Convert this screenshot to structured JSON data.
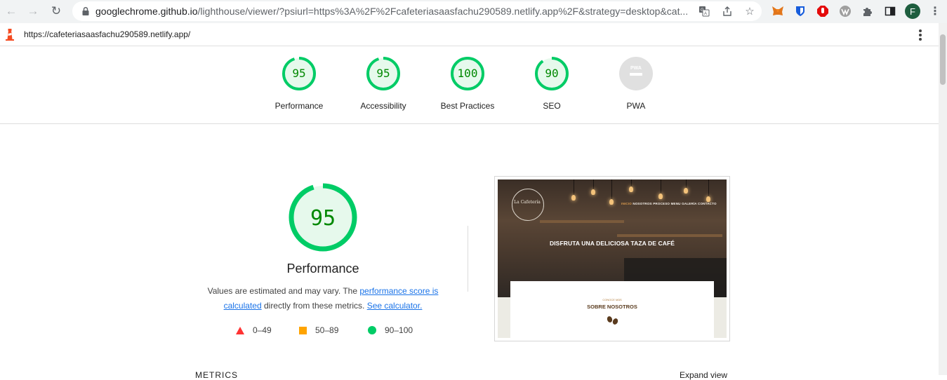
{
  "browser": {
    "url_host": "googlechrome.github.io",
    "url_rest": "/lighthouse/viewer/?psiurl=https%3A%2F%2Fcafeteriasaasfachu290589.netlify.app%2F&strategy=desktop&cat...",
    "avatar_initial": "F"
  },
  "report": {
    "url": "https://cafeteriasaasfachu290589.netlify.app/"
  },
  "gauges": [
    {
      "label": "Performance",
      "score": "95",
      "value": 95
    },
    {
      "label": "Accessibility",
      "score": "95",
      "value": 95
    },
    {
      "label": "Best Practices",
      "score": "100",
      "value": 100
    },
    {
      "label": "SEO",
      "score": "90",
      "value": 90
    },
    {
      "label": "PWA",
      "badge": "PWA"
    }
  ],
  "main": {
    "score": "95",
    "value": 95,
    "title": "Performance",
    "desc_pre": "Values are estimated and may vary. The ",
    "link_score": "performance score is calculated",
    "desc_mid": " directly from these metrics. ",
    "link_calc": "See calculator."
  },
  "legend": [
    {
      "range": "0–49"
    },
    {
      "range": "50–89"
    },
    {
      "range": "90–100"
    }
  ],
  "screenshot": {
    "logo": "La Cafetería",
    "nav_active": "INICIO",
    "nav_rest": "NOSOTROS  PROCESO  MENU  GALERÍA  CONTACTO",
    "headline": "DISFRUTA UNA DELICIOSA TAZA DE CAFÉ",
    "kicker": "CONOCE MÁS",
    "subheading": "SOBRE NOSOTROS"
  },
  "bottom": {
    "left_heading": "METRICS",
    "right_heading": "Expand view"
  },
  "colors": {
    "pass": "#0c6",
    "pass_text": "#008800",
    "pass_bg": "#e6f9ec",
    "average": "#ffa400",
    "fail": "#ff3333",
    "na": "#e0e0e0"
  }
}
